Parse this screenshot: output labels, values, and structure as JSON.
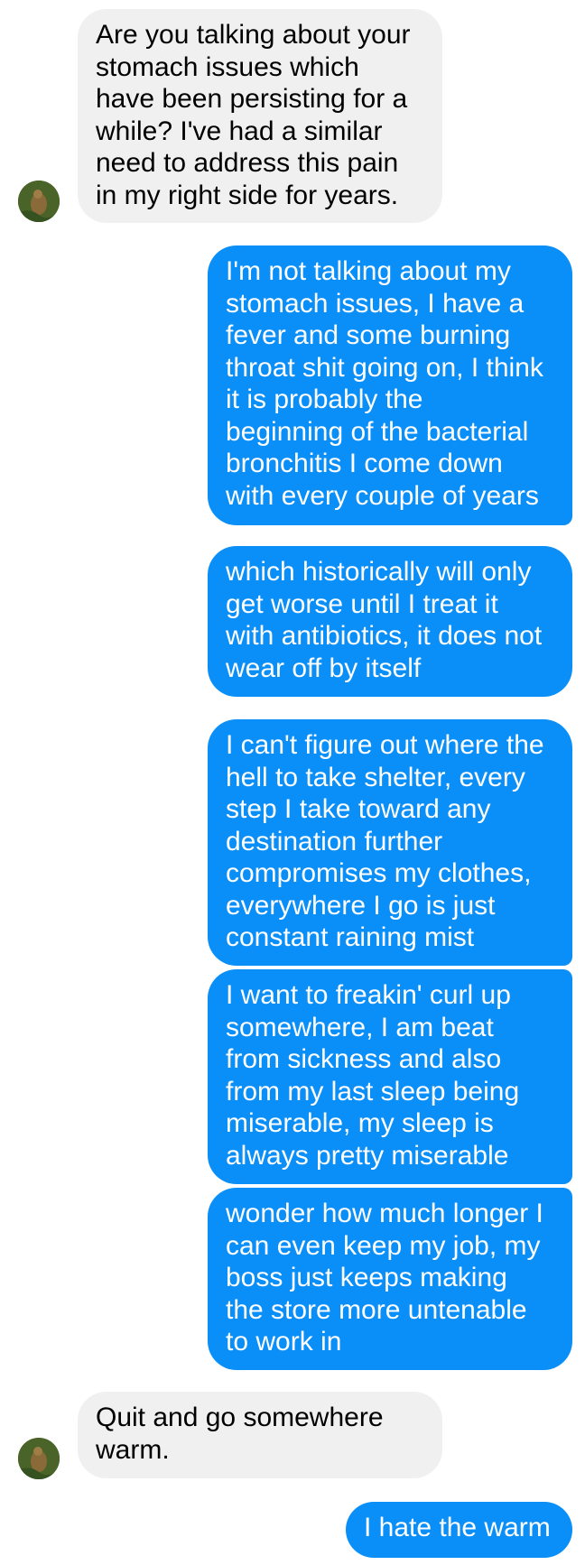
{
  "conversation": {
    "messages": [
      {
        "sender": "them",
        "text": "Are you talking about your\nstomach issues which\nhave been persisting for a\nwhile? I've had a similar\nneed to address this pain\nin my right side for years."
      },
      {
        "sender": "me",
        "text": "I'm not talking about my\nstomach issues, I have a\nfever and some burning\nthroat shit going on, I think\nit is probably the\nbeginning of the bacterial\nbronchitis I come down\nwith every couple of years"
      },
      {
        "sender": "me",
        "text": "which historically will only\nget worse until I treat it\nwith antibiotics, it does not\nwear off by itself"
      },
      {
        "sender": "me",
        "text": "I can't figure out where the\nhell to take shelter, every\nstep I take toward any\ndestination further\ncompromises my clothes,\neverywhere I go is just\nconstant raining mist"
      },
      {
        "sender": "me",
        "text": "I want to freakin' curl up\nsomewhere, I am beat\nfrom sickness and also\nfrom my last sleep being\nmiserable, my sleep is\nalways pretty miserable"
      },
      {
        "sender": "me",
        "text": "wonder how much longer I\ncan even keep my job, my\nboss just keeps making\nthe store more untenable\nto work in"
      },
      {
        "sender": "them",
        "text": "Quit and go somewhere\nwarm."
      },
      {
        "sender": "me",
        "text": "I hate the warm"
      }
    ]
  },
  "colors": {
    "outgoing_bubble": "#0a8ef8",
    "incoming_bubble": "#f0f0f0",
    "background": "#ffffff"
  }
}
